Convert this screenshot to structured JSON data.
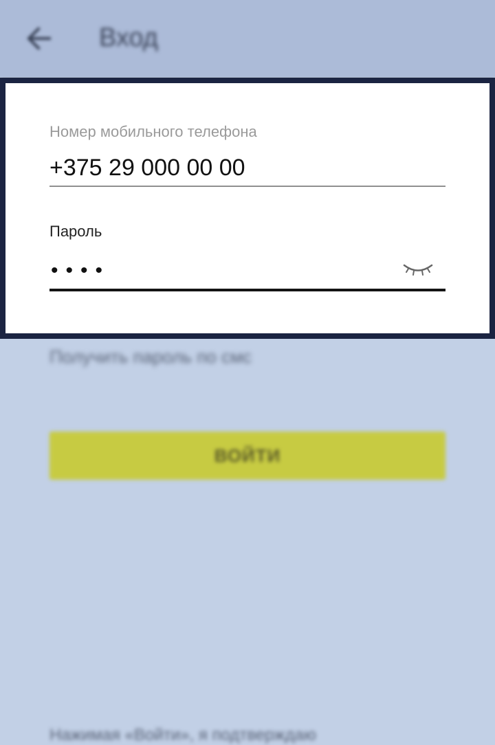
{
  "appbar": {
    "title": "Вход",
    "back_icon": "arrow-left-icon",
    "background": "#acbbd8"
  },
  "form": {
    "phone": {
      "label": "Номер мобильного телефона",
      "value": "+375 29 000 00 00"
    },
    "password": {
      "label": "Пароль",
      "masked_value": "••••",
      "visibility_icon": "eye-closed-icon"
    }
  },
  "background_content": {
    "get_password_link": "Получить пароль по смс",
    "login_button": "ВОЙТИ",
    "bottom_text": "Нажимая «Войти», я подтверждаю"
  },
  "colors": {
    "page_background": "#c2d0e6",
    "login_button": "#c7cb42",
    "focus_border": "#1b2442"
  }
}
